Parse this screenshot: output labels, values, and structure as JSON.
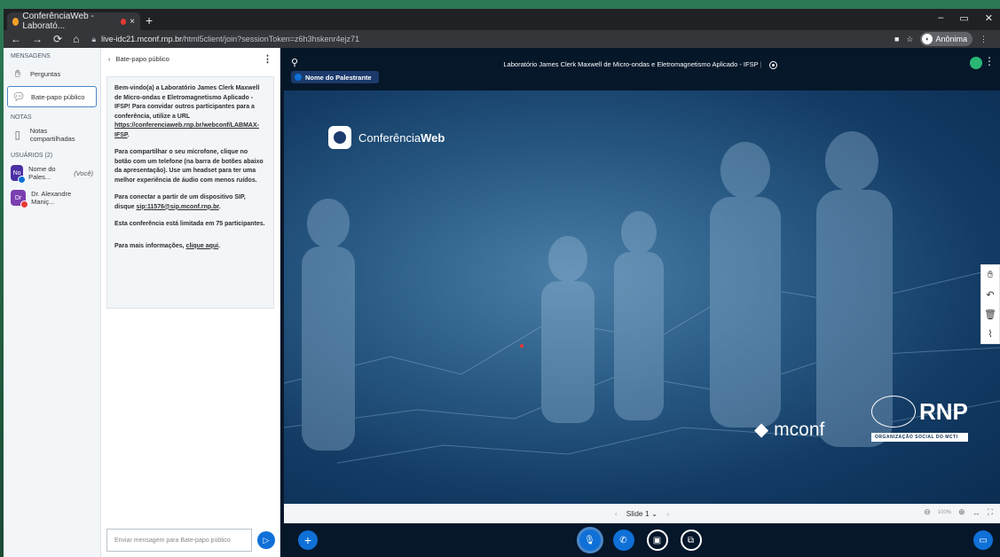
{
  "browser": {
    "tab_title": "ConferênciaWeb - Laborató...",
    "tab_close": "×",
    "new_tab": "+",
    "url_host": "live-idc21.mconf.rnp.br",
    "url_path": "/html5client/join?sessionToken=z6h3hskenr4ejz71",
    "profile_label": "Anônima"
  },
  "sidebar": {
    "messages_title": "MENSAGENS",
    "items": [
      {
        "label": "Perguntas",
        "icon": "hand-icon"
      },
      {
        "label": "Bate-papo público",
        "icon": "chat-icon"
      }
    ],
    "notes_title": "NOTAS",
    "notes_item": "Notas compartilhadas",
    "users_title": "USUÁRIOS (2)",
    "users": [
      {
        "initials": "No",
        "name": "Nome do Pales...",
        "you": "(Você)",
        "color": "#4b2fa3",
        "status_color": "#0f70d7"
      },
      {
        "initials": "Dr",
        "name": "Dr. Alexandre Maniç...",
        "color": "#7b3fb0",
        "status_color": "#e53935"
      }
    ]
  },
  "chat": {
    "back_label": "Bate-papo público",
    "welcome": {
      "p1": "Bem-vindo(a) a Laboratório James Clerk Maxwell de Micro-ondas e Eletromagnetismo Aplicado - IFSP! Para convidar outros participantes para a conferência, utilize a URL",
      "url": "https://conferenciaweb.rnp.br/webconf/LABMAX-IFSP",
      "p2": "Para compartilhar o seu microfone, clique no botão com um telefone (na barra de botões abaixo da apresentação). Use um headset para ter uma melhor experiência de áudio com menos ruídos.",
      "p3_a": "Para conectar a partir de um dispositivo SIP, disque",
      "sip": "sip:11576@sip.mconf.rnp.br",
      "p4": "Esta conferência está limitada em 75 participantes.",
      "p5_a": "Para mais informações,",
      "p5_link": "clique aqui"
    },
    "input_placeholder": "Enviar mensagem para Bate-papo público"
  },
  "presentation": {
    "title": "Laboratório James Clerk Maxwell de Micro-ondas e Eletromagnetismo Aplicado - IFSP",
    "speaker_label": "Nome do Palestrante",
    "slide_logo_a": "Conferência",
    "slide_logo_b": "Web",
    "mconf_label": "mconf",
    "rnp_label": "RNP",
    "rnp_sub": "ORGANIZAÇÃO SOCIAL DO MCTI",
    "slide_label": "Slide 1",
    "zoom_pct": "100%"
  }
}
